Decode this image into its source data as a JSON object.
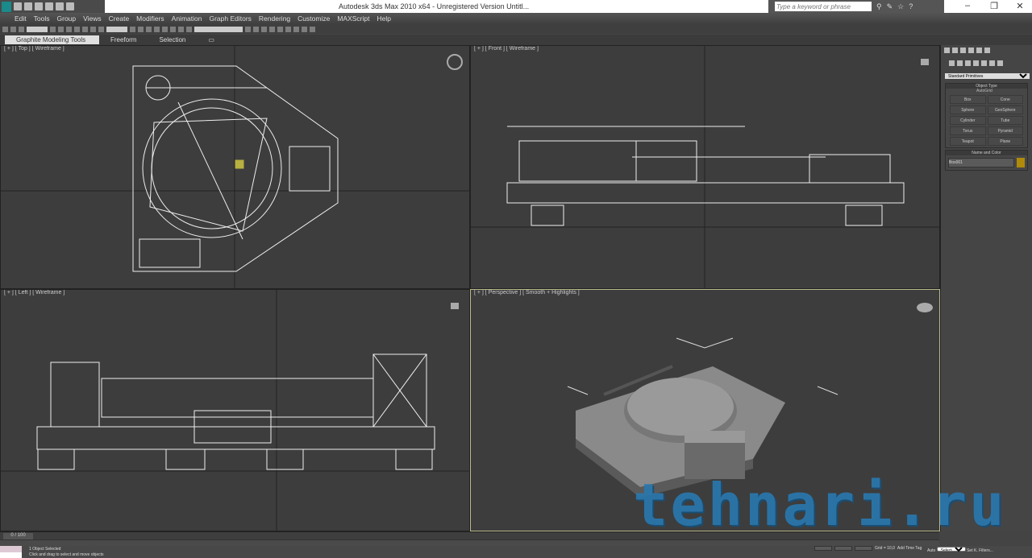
{
  "window": {
    "title": "Autodesk 3ds Max  2010 x64  - Unregistered Version      Untitl...",
    "search_placeholder": "Type a keyword or phrase",
    "minimize": "–",
    "restore": "❐",
    "close": "✕"
  },
  "menu": [
    "Edit",
    "Tools",
    "Group",
    "Views",
    "Create",
    "Modifiers",
    "Animation",
    "Graph Editors",
    "Rendering",
    "Customize",
    "MAXScript",
    "Help"
  ],
  "ribbon": {
    "tabs": [
      "Graphite Modeling Tools",
      "Freeform",
      "Selection"
    ]
  },
  "viewports": {
    "top": "[ + ] [ Top ] [ Wireframe ]",
    "front": "[ + ] [ Front ] [ Wireframe ]",
    "left": "[ + ] [ Left ] [ Wireframe ]",
    "perspective": "[ + ] [ Perspective ] [ Smooth + Highlights ]"
  },
  "command_panel": {
    "category": "Standard Primitives",
    "object_type": "Object Type",
    "autogrid": "AutoGrid",
    "buttons": [
      "Box",
      "Cone",
      "Sphere",
      "GeoSphere",
      "Cylinder",
      "Tube",
      "Torus",
      "Pyramid",
      "Teapot",
      "Plane"
    ],
    "name_and_color": "Name and Color",
    "object_name": "Box001",
    "color": "#b08a0a"
  },
  "timeline": {
    "frame": "0 / 100"
  },
  "status": {
    "selection": "1 Object Selected",
    "prompt": "Click and drag to select and move objects",
    "add_time_tag": "Add Time Tag",
    "auto": "Auto",
    "set_key": "Set K.",
    "key_filter": "Selected",
    "filters": "Filters...",
    "grid": "Grid = 10,0"
  },
  "watermark": "tehnari.ru"
}
